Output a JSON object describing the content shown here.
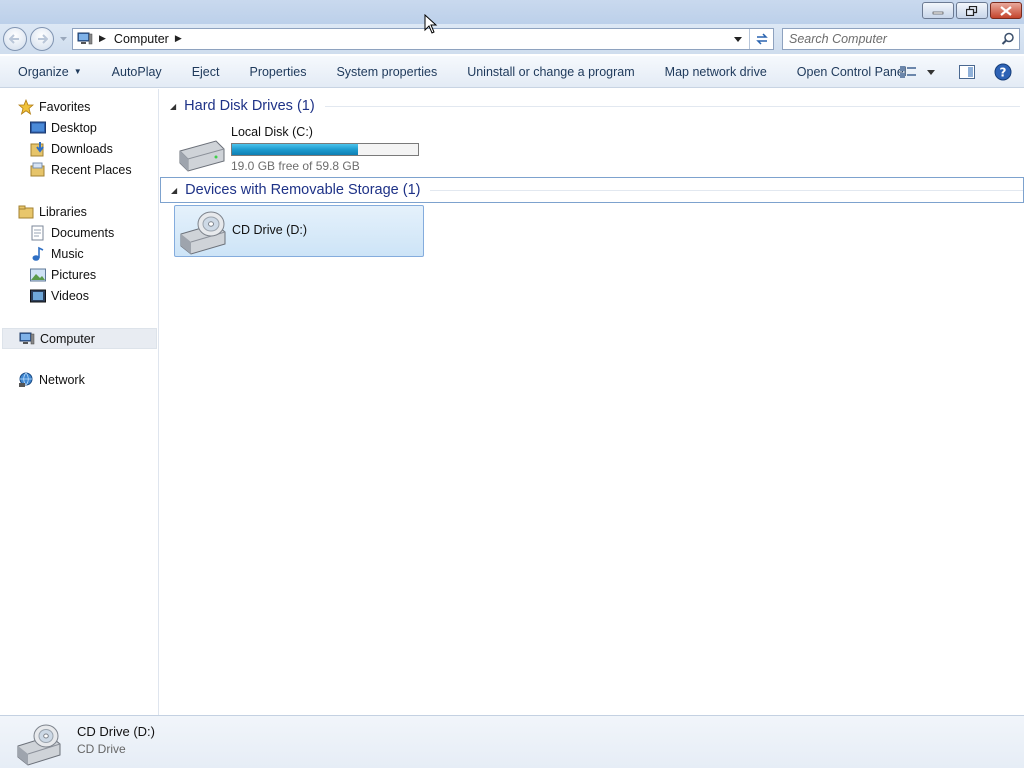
{
  "window": {
    "title": "Computer",
    "controls": {
      "minimize": "minimize",
      "restore": "restore",
      "close": "close"
    }
  },
  "navbar": {
    "breadcrumb": [
      "Computer"
    ],
    "search_placeholder": "Search Computer"
  },
  "commandbar": {
    "items": [
      {
        "label": "Organize",
        "has_dropdown": true
      },
      {
        "label": "AutoPlay"
      },
      {
        "label": "Eject"
      },
      {
        "label": "Properties"
      },
      {
        "label": "System properties"
      },
      {
        "label": "Uninstall or change a program"
      },
      {
        "label": "Map network drive"
      },
      {
        "label": "Open Control Panel"
      }
    ],
    "right_icons": [
      "view-options-icon",
      "preview-pane-icon",
      "help-icon"
    ]
  },
  "navpane": {
    "favorites": {
      "label": "Favorites",
      "items": [
        {
          "label": "Desktop",
          "icon": "desktop-icon"
        },
        {
          "label": "Downloads",
          "icon": "downloads-icon"
        },
        {
          "label": "Recent Places",
          "icon": "recent-places-icon"
        }
      ]
    },
    "libraries": {
      "label": "Libraries",
      "items": [
        {
          "label": "Documents",
          "icon": "documents-icon"
        },
        {
          "label": "Music",
          "icon": "music-icon"
        },
        {
          "label": "Pictures",
          "icon": "pictures-icon"
        },
        {
          "label": "Videos",
          "icon": "videos-icon"
        }
      ]
    },
    "computer": {
      "label": "Computer",
      "selected": true
    },
    "network": {
      "label": "Network"
    }
  },
  "content": {
    "groups": [
      {
        "title": "Hard Disk Drives (1)",
        "items": [
          {
            "name": "Local Disk (C:)",
            "free_text": "19.0 GB free of 59.8 GB",
            "used_fraction": 0.68
          }
        ]
      },
      {
        "title": "Devices with Removable Storage (1)",
        "focused": true,
        "items": [
          {
            "name": "CD Drive (D:)",
            "selected": true
          }
        ]
      }
    ]
  },
  "details": {
    "name": "CD Drive (D:)",
    "type": "CD Drive"
  },
  "colors": {
    "group_title": "#1e3287",
    "progress_fill": "#1d9bcf",
    "selection": "#cde4f7"
  }
}
